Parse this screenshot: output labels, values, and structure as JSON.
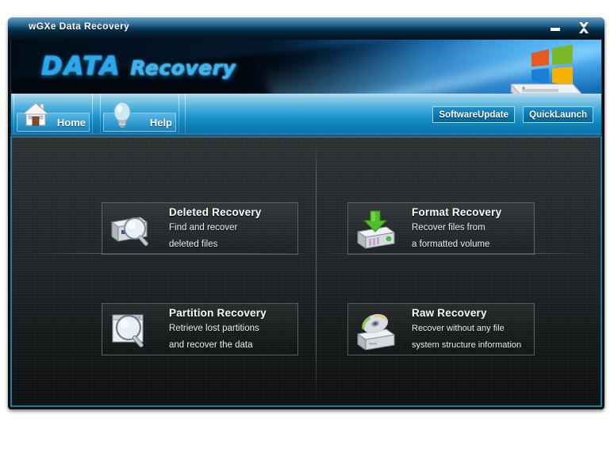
{
  "window": {
    "title": "wGXe Data Recovery",
    "minimize_label": "Minimize",
    "close_label": "Close"
  },
  "banner": {
    "title_main": "DATA",
    "title_sub": "Recovery",
    "icon": "windows-harddrive-icon"
  },
  "toolbar": {
    "items": [
      {
        "label": "Home",
        "icon": "house-icon"
      },
      {
        "label": "Help",
        "icon": "lightbulb-icon"
      }
    ],
    "software_update_label": "SoftwareUpdate",
    "quick_launch_label": "QuickLaunch"
  },
  "main": {
    "cards": [
      {
        "title": "Deleted Recovery",
        "line1": "Find and recover",
        "line2": "deleted files",
        "icon": "drive-magnifier-icon"
      },
      {
        "title": "Format Recovery",
        "line1": "Recover files from",
        "line2": "a formatted volume",
        "icon": "drive-green-arrow-icon"
      },
      {
        "title": "Partition Recovery",
        "line1": "Retrieve lost partitions",
        "line2": "and recover the data",
        "icon": "window-magnifier-icon"
      },
      {
        "title": "Raw Recovery",
        "line1": "Recover without any file",
        "line2": "system structure information",
        "icon": "cd-drive-icon"
      }
    ]
  },
  "colors": {
    "accent_blue": "#2aa8ef",
    "toolbar_blue": "#1c92cb",
    "titlebar_dark": "#041d2e",
    "content_dark": "#1c2022",
    "border_teal": "#1a7fa8"
  }
}
